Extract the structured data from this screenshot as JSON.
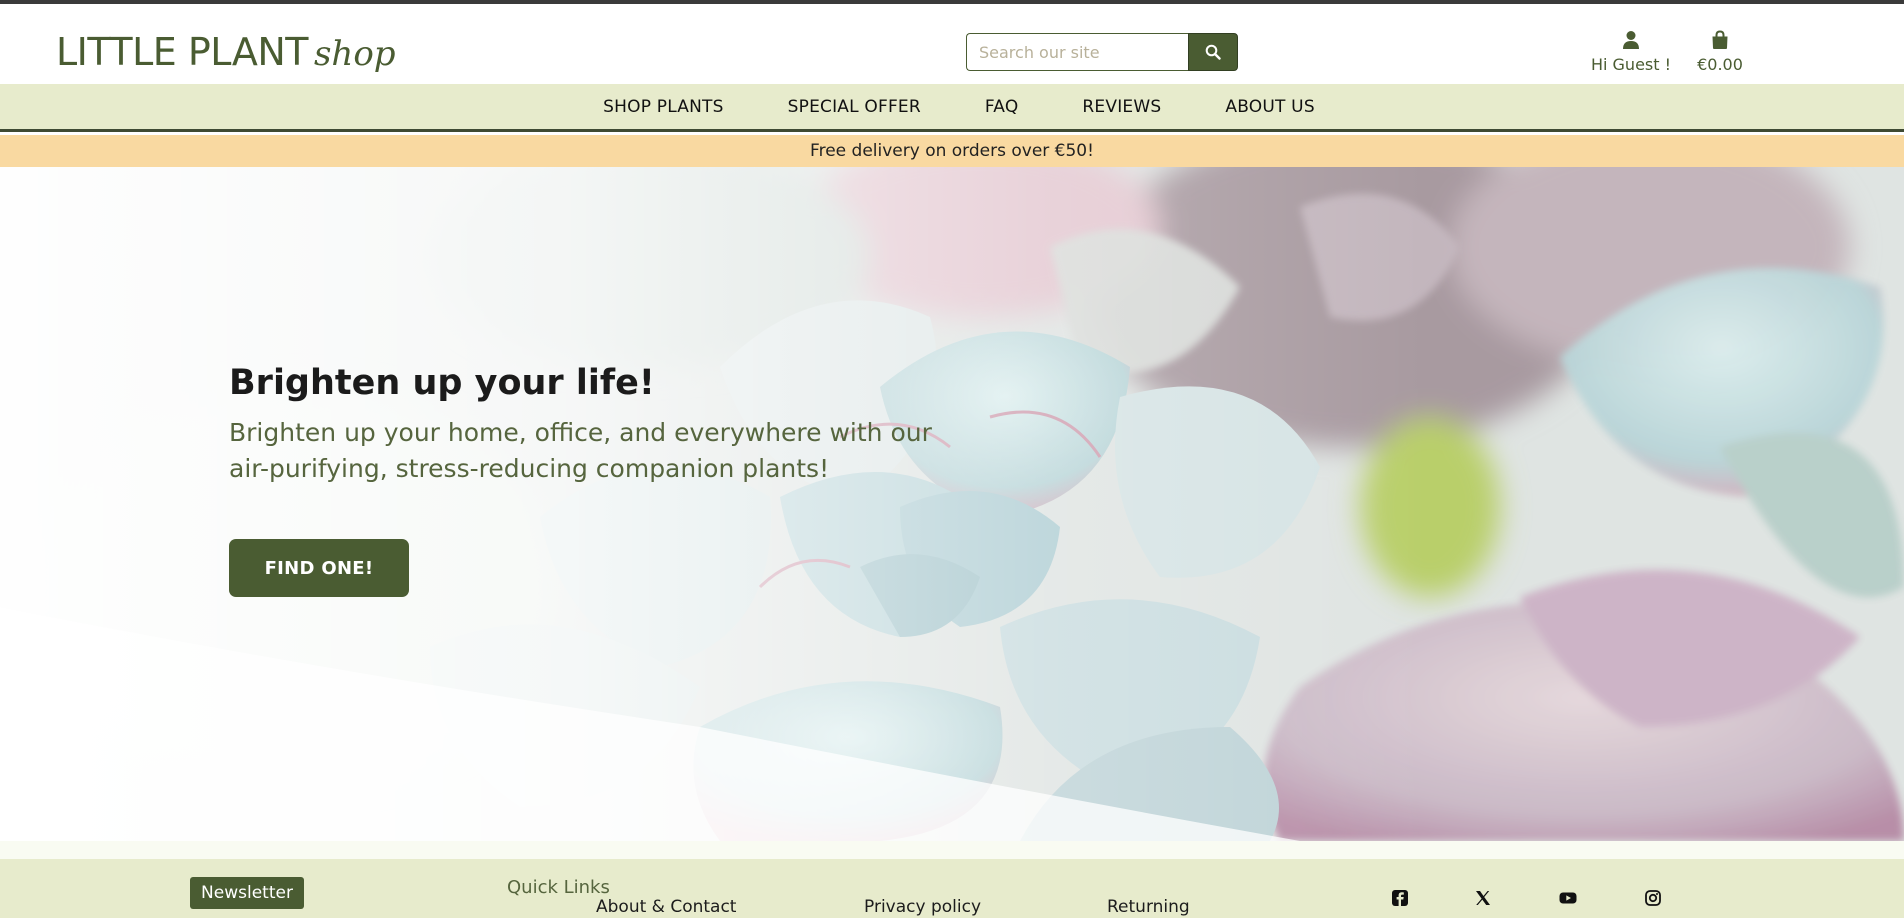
{
  "brand": {
    "name_main": "LITTLE PLANT",
    "name_sub": "shop"
  },
  "search": {
    "placeholder": "Search our site"
  },
  "account": {
    "greeting": "Hi Guest !",
    "icon": "user-icon"
  },
  "bag": {
    "total": "€0.00",
    "icon": "shopping-bag-icon"
  },
  "nav": {
    "items": [
      "SHOP PLANTS",
      "SPECIAL OFFER",
      "FAQ",
      "REVIEWS",
      "ABOUT US"
    ]
  },
  "banner": {
    "text": "Free delivery on orders over €50!"
  },
  "hero": {
    "title": "Brighten up your life!",
    "subtitle": "Brighten up your home, office, and everywhere with our air-purifying, stress-reducing companion plants!",
    "cta": "FIND ONE!"
  },
  "footer": {
    "newsletter_label": "Newsletter",
    "quick_links_title": "Quick Links",
    "links": [
      "About & Contact",
      "Privacy policy",
      "Returning"
    ],
    "social_icons": [
      "facebook-icon",
      "x-icon",
      "youtube-icon",
      "instagram-icon"
    ]
  },
  "colors": {
    "brand_green": "#4a5c32",
    "nav_background": "#e7ebcc",
    "banner_background": "#f9d9a1"
  }
}
